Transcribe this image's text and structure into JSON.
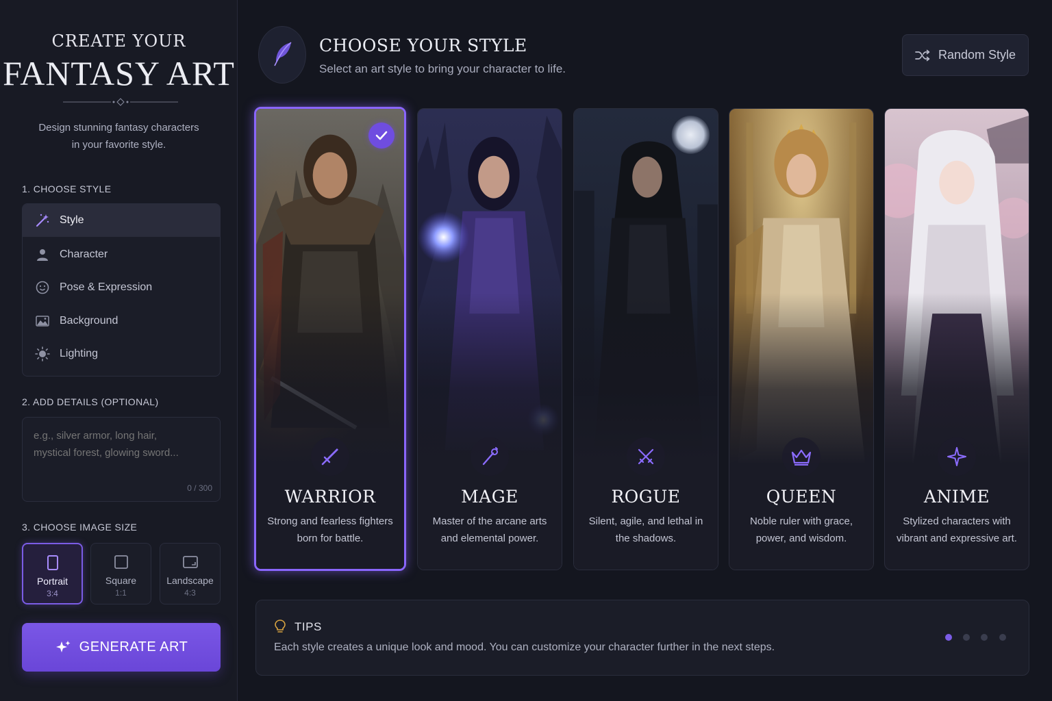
{
  "brand": {
    "top": "CREATE YOUR",
    "main": "FANTASY ART",
    "subtitle_line1": "Design stunning fantasy characters",
    "subtitle_line2": "in your favorite style."
  },
  "sidebar": {
    "section1_label": "1. CHOOSE STYLE",
    "steps": [
      {
        "label": "Style",
        "icon": "magic-wand-icon",
        "active": true
      },
      {
        "label": "Character",
        "icon": "person-icon"
      },
      {
        "label": "Pose & Expression",
        "icon": "smiley-icon"
      },
      {
        "label": "Background",
        "icon": "landscape-icon"
      },
      {
        "label": "Lighting",
        "icon": "sun-icon"
      }
    ],
    "section2_label": "2. ADD DETAILS (OPTIONAL)",
    "details_placeholder": "e.g., silver armor, long hair,\nmystical forest, glowing sword...",
    "details_counter": "0 / 300",
    "section3_label": "3. CHOOSE IMAGE SIZE",
    "sizes": [
      {
        "name": "Portrait",
        "ratio": "3:4",
        "active": true
      },
      {
        "name": "Square",
        "ratio": "1:1"
      },
      {
        "name": "Landscape",
        "ratio": "4:3"
      }
    ],
    "generate_label": "GENERATE ART"
  },
  "header": {
    "title": "CHOOSE YOUR STYLE",
    "subtitle": "Select an art style to bring your character to life.",
    "random_label": "Random Style"
  },
  "styles": [
    {
      "name": "WARRIOR",
      "desc": "Strong and fearless fighters born for battle.",
      "icon": "sword-icon",
      "selected": true
    },
    {
      "name": "MAGE",
      "desc": "Master of the arcane arts and elemental power.",
      "icon": "staff-icon"
    },
    {
      "name": "ROGUE",
      "desc": "Silent, agile, and lethal in the shadows.",
      "icon": "crossed-daggers-icon"
    },
    {
      "name": "QUEEN",
      "desc": "Noble ruler with grace, power, and wisdom.",
      "icon": "crown-icon"
    },
    {
      "name": "ANIME",
      "desc": "Stylized characters with vibrant and expressive art.",
      "icon": "sparkle-icon"
    }
  ],
  "tips": {
    "title": "TIPS",
    "text": "Each style creates a unique look and mood. You can customize your character further in the next steps.",
    "page_count": 4,
    "active_page": 1
  },
  "colors": {
    "accent": "#7b5ce6",
    "background": "#14161f",
    "panel": "#1b1d28"
  }
}
